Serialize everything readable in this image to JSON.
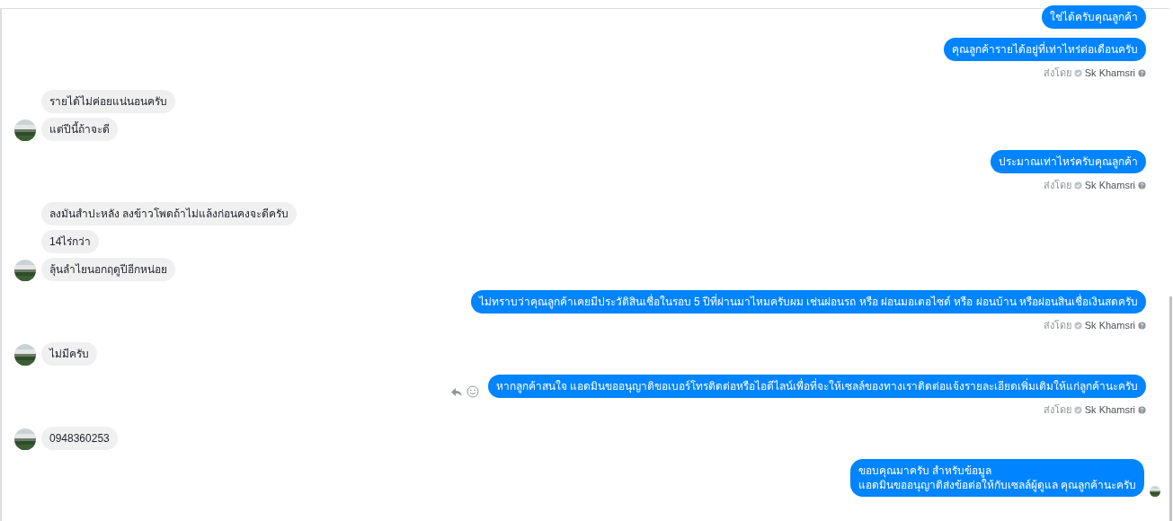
{
  "groups": [
    {
      "kind": "outgoing",
      "messages": [
        "ใช่ได้ครับคุณลูกค้า"
      ]
    },
    {
      "kind": "outgoing",
      "messages": [
        "คุณลูกค้ารายได้อยู่ที่เท่าไหร่ต่อเดือนครับ"
      ],
      "sent_by": {
        "label": "ส่งโดย",
        "name": "Sk Khamsri"
      }
    },
    {
      "kind": "incoming",
      "messages": [
        "รายได้ไม่ค่อยแน่นอนครับ",
        "แต่ปีนี้ถ้าจะดี"
      ]
    },
    {
      "kind": "outgoing",
      "messages": [
        "ประมาณเท่าไหร่ครับคุณลูกค้า"
      ],
      "sent_by": {
        "label": "ส่งโดย",
        "name": "Sk Khamsri"
      }
    },
    {
      "kind": "incoming",
      "messages": [
        "ลงมันสำปะหลัง ลงข้าวโพดถ้าไม่แล้งก่อนคงจะดีครับ",
        "14ไร่กว่า",
        "ลุ้นลำไยนอกฤดูปีอีกหน่อย"
      ]
    },
    {
      "kind": "outgoing",
      "messages": [
        "ไม่ทราบว่าคุณลูกค้าเคยมีประวัติสินเชื่อในรอบ 5 ปีที่ผ่านมาไหมครับผม เช่นผ่อนรถ หรือ ผ่อนมอเตอไซด์ หรือ ผ่อนบ้าน หรือผ่อนสินเชื่อเงินสดครับ"
      ],
      "sent_by": {
        "label": "ส่งโดย",
        "name": "Sk Khamsri"
      }
    },
    {
      "kind": "incoming",
      "messages": [
        "ไม่มีครับ"
      ]
    },
    {
      "kind": "outgoing",
      "hover_actions": true,
      "messages": [
        "หากลูกค้าสนใจ แอดมินขออนุญาติขอเบอร์โทรติดต่อหรือไอดีไลน์เพื่อที่จะให้เซลล์ของทางเราติดต่อแจ้งรายละเอียดเพิ่มเติมให้แก่ลูกค้านะครับ"
      ],
      "sent_by": {
        "label": "ส่งโดย",
        "name": "Sk Khamsri"
      }
    },
    {
      "kind": "incoming",
      "messages": [
        "0948360253"
      ]
    },
    {
      "kind": "outgoing",
      "seen": true,
      "messages": [
        "ขอบคุณมาครับ สำหรับข้อมูล\nแอดมินขออนุญาติส่งข้อต่อให้กับเซลล์ผู้ดูแล คุณลูกค้านะครับ"
      ]
    }
  ]
}
